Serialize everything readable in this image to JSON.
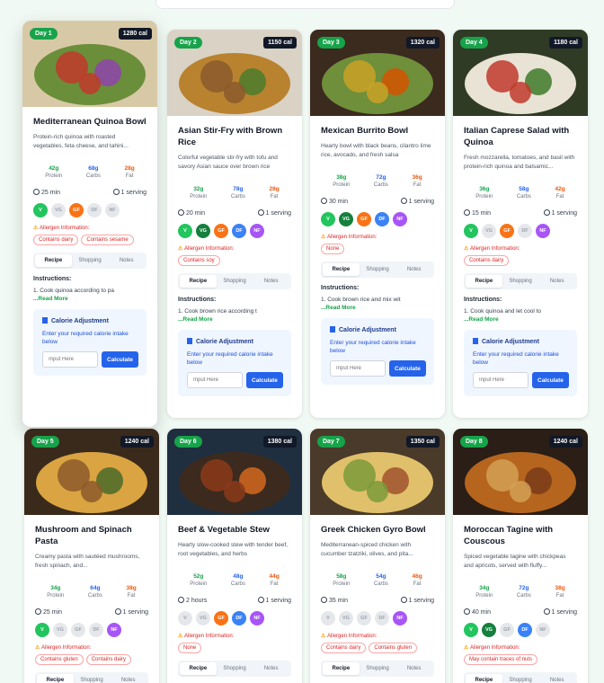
{
  "labels": {
    "protein": "Protein",
    "carbs": "Carbs",
    "fat": "Fat",
    "allergen_heading": "Allergen Information:",
    "tab_recipe": "Recipe",
    "tab_shopping": "Shopping",
    "tab_notes": "Notes",
    "instructions": "Instructions:",
    "read_more": "...Read More",
    "cal_title": "Calorie Adjustment",
    "cal_desc": "Enter your required calorie intake below",
    "cal_placeholder": "Input Here",
    "cal_button": "Calculate"
  },
  "meals": [
    {
      "day": "Day 1",
      "cal": "1280 cal",
      "title": "Mediterranean Quinoa Bowl",
      "desc": "Protein-rich quinoa with roasted vegetables, feta cheese, and tahini...",
      "protein": "42g",
      "carbs": "68g",
      "fat": "28g",
      "time": "25 min",
      "serving": "1 serving",
      "tags": {
        "V": true,
        "VG": false,
        "GF": true,
        "DF": false,
        "NF": false
      },
      "allergens": [
        "Contains dairy",
        "Contains sesame"
      ],
      "instruction": "1. Cook quinoa according to pa",
      "theme": "quinoa"
    },
    {
      "day": "Day 2",
      "cal": "1150 cal",
      "title": "Asian Stir-Fry with Brown Rice",
      "desc": "Colorful vegetable stir-fry with tofu and savory Asian sauce over brown rice",
      "protein": "32g",
      "carbs": "78g",
      "fat": "28g",
      "time": "20 min",
      "serving": "1 serving",
      "tags": {
        "V": true,
        "VG": true,
        "GF": true,
        "DF": true,
        "NF": true
      },
      "allergens": [
        "Contains soy"
      ],
      "instruction": "1. Cook brown rice according t",
      "theme": "rice"
    },
    {
      "day": "Day 3",
      "cal": "1320 cal",
      "title": "Mexican Burrito Bowl",
      "desc": "Hearty bowl with black beans, cilantro lime rice, avocado, and fresh salsa",
      "protein": "38g",
      "carbs": "72g",
      "fat": "36g",
      "time": "30 min",
      "serving": "1 serving",
      "tags": {
        "V": true,
        "VG": true,
        "GF": true,
        "DF": true,
        "NF": true
      },
      "allergens": [
        "None"
      ],
      "instruction": "1. Cook brown rice and mix wit",
      "theme": "burrito"
    },
    {
      "day": "Day 4",
      "cal": "1180 cal",
      "title": "Italian Caprese Salad with Quinoa",
      "desc": "Fresh mozzarella, tomatoes, and basil with protein-rich quinoa and balsamic...",
      "protein": "36g",
      "carbs": "58g",
      "fat": "42g",
      "time": "15 min",
      "serving": "1 serving",
      "tags": {
        "V": true,
        "VG": false,
        "GF": true,
        "DF": false,
        "NF": true
      },
      "allergens": [
        "Contains dairy"
      ],
      "instruction": "1. Cook quinoa and let cool to",
      "theme": "caprese"
    },
    {
      "day": "Day 5",
      "cal": "1240 cal",
      "title": "Mushroom and Spinach Pasta",
      "desc": "Creamy pasta with sautéed mushrooms, fresh spinach, and...",
      "protein": "34g",
      "carbs": "64g",
      "fat": "38g",
      "time": "25 min",
      "serving": "1 serving",
      "tags": {
        "V": true,
        "VG": false,
        "GF": false,
        "DF": false,
        "NF": true
      },
      "allergens": [
        "Contains gluten",
        "Contains dairy"
      ],
      "instruction": "",
      "theme": "pasta"
    },
    {
      "day": "Day 6",
      "cal": "1380 cal",
      "title": "Beef & Vegetable Stew",
      "desc": "Hearty slow-cooked stew with tender beef, root vegetables, and herbs",
      "protein": "52g",
      "carbs": "48g",
      "fat": "44g",
      "time": "2 hours",
      "serving": "1 serving",
      "tags": {
        "V": false,
        "VG": false,
        "GF": true,
        "DF": true,
        "NF": true
      },
      "allergens": [
        "None"
      ],
      "instruction": "",
      "theme": "stew"
    },
    {
      "day": "Day 7",
      "cal": "1350 cal",
      "title": "Greek Chicken Gyro Bowl",
      "desc": "Mediterranean-spiced chicken with cucumber tzatziki, olives, and pita...",
      "protein": "58g",
      "carbs": "54g",
      "fat": "46g",
      "time": "35 min",
      "serving": "1 serving",
      "tags": {
        "V": false,
        "VG": false,
        "GF": false,
        "DF": false,
        "NF": true
      },
      "allergens": [
        "Contains dairy",
        "Contains gluten"
      ],
      "instruction": "",
      "theme": "gyro"
    },
    {
      "day": "Day 8",
      "cal": "1240 cal",
      "title": "Moroccan Tagine with Couscous",
      "desc": "Spiced vegetable tagine with chickpeas and apricots, served with fluffy...",
      "protein": "34g",
      "carbs": "72g",
      "fat": "38g",
      "time": "40 min",
      "serving": "1 serving",
      "tags": {
        "V": true,
        "VG": true,
        "GF": false,
        "DF": true,
        "NF": false
      },
      "allergens": [
        "May contain traces of nuts"
      ],
      "instruction": "",
      "theme": "tagine"
    }
  ]
}
